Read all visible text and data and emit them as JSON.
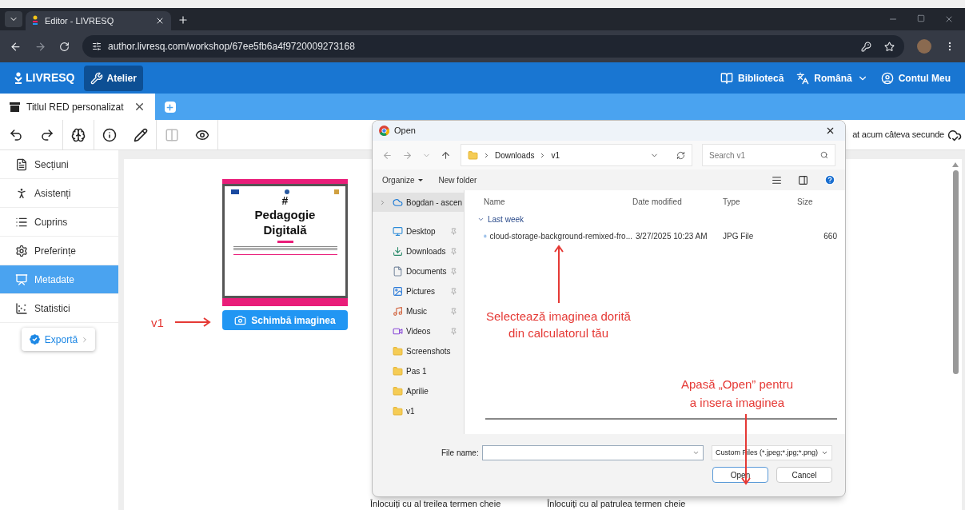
{
  "browser": {
    "tab_title": "Editor - LIVRESQ",
    "url": "author.livresq.com/workshop/67ee5fb6a4f9720009273168"
  },
  "app_header": {
    "logo": "LIVRESQ",
    "nav": [
      {
        "label": "Atelier",
        "selected": true
      }
    ],
    "right": [
      {
        "label": "Bibliotecă",
        "kind": "library"
      },
      {
        "label": "Română",
        "kind": "language"
      },
      {
        "label": "Contul Meu",
        "kind": "account"
      }
    ]
  },
  "doc_tabs": [
    {
      "label": "Titlul RED personalizat",
      "selected": true
    }
  ],
  "toolbar": {
    "tools": [
      {
        "kind": "undo",
        "disabled": false
      },
      {
        "kind": "redo",
        "disabled": false
      },
      {
        "kind": "assistant",
        "disabled": false
      },
      {
        "kind": "info",
        "disabled": false
      },
      {
        "kind": "edit",
        "disabled": false
      },
      {
        "kind": "layout",
        "disabled": true
      },
      {
        "kind": "preview",
        "disabled": false
      }
    ],
    "save_status": "at acum câteva secunde"
  },
  "sidebar": {
    "items": [
      {
        "label": "Secțiuni",
        "kind": "sections",
        "selected": false
      },
      {
        "label": "Asistenți",
        "kind": "assistants",
        "selected": false
      },
      {
        "label": "Cuprins",
        "kind": "contents",
        "selected": false
      },
      {
        "label": "Preferințe",
        "kind": "preferences",
        "selected": false
      },
      {
        "label": "Metadate",
        "kind": "metadata",
        "selected": true
      },
      {
        "label": "Statistici",
        "kind": "statistics",
        "selected": false
      }
    ],
    "export_button": "Exportă"
  },
  "cover": {
    "hash": "#",
    "title": "Pedagogie Digitală",
    "button": "Schimbă imaginea"
  },
  "background_text": [
    "Înlocuiți cu al treilea termen cheie",
    "Înlocuiți cu al patrulea termen cheie"
  ],
  "dialog": {
    "title": "Open",
    "path": [
      "Downloads",
      "v1"
    ],
    "search_placeholder": "Search v1",
    "commands": [
      "Organize",
      "New folder"
    ],
    "nav": [
      {
        "label": "Bogdan - ascen",
        "kind": "cloud",
        "pinned": false
      },
      {
        "label": "Desktop",
        "kind": "desktop",
        "pinned": true
      },
      {
        "label": "Downloads",
        "kind": "downloads",
        "pinned": true
      },
      {
        "label": "Documents",
        "kind": "documents",
        "pinned": true
      },
      {
        "label": "Pictures",
        "kind": "pictures",
        "pinned": true
      },
      {
        "label": "Music",
        "kind": "music",
        "pinned": true
      },
      {
        "label": "Videos",
        "kind": "videos",
        "pinned": true
      },
      {
        "label": "Screenshots",
        "kind": "folder",
        "pinned": false
      },
      {
        "label": "Pas 1",
        "kind": "folder",
        "pinned": false
      },
      {
        "label": "Aprilie",
        "kind": "folder",
        "pinned": false
      },
      {
        "label": "v1",
        "kind": "folder",
        "pinned": false
      }
    ],
    "columns": [
      "Name",
      "Date modified",
      "Type",
      "Size"
    ],
    "group": "Last week",
    "files": [
      {
        "name": "cloud-storage-background-remixed-fro...",
        "date": "3/27/2025 10:23 AM",
        "type": "JPG File",
        "size": "660"
      }
    ],
    "file_name_label": "File name:",
    "filter": "Custom Files (*.jpeg;*.jpg;*.png)",
    "buttons": [
      "Open",
      "Cancel"
    ]
  },
  "annotations": [
    {
      "kind": "v1",
      "text": "v1"
    },
    {
      "kind": "select",
      "text": "Selectează imaginea dorită din calculatorul tău"
    },
    {
      "kind": "open",
      "text": "Apasă „Open” pentru a insera imaginea"
    }
  ]
}
